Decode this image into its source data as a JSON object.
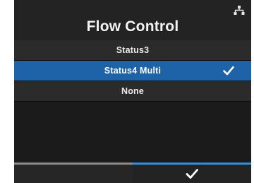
{
  "screen": {
    "title": "Flow Control",
    "status_icon": "network-icon"
  },
  "options": [
    {
      "label": "Status3",
      "selected": false
    },
    {
      "label": "Status4 Multi",
      "selected": true
    },
    {
      "label": "None",
      "selected": false
    }
  ],
  "footer": {
    "left_button": "",
    "right_button_icon": "checkmark-icon"
  },
  "colors": {
    "background": "#1b1b1b",
    "highlight": "#1e63a8",
    "accent_bar": "#2f8fe0",
    "text": "#ffffff"
  }
}
